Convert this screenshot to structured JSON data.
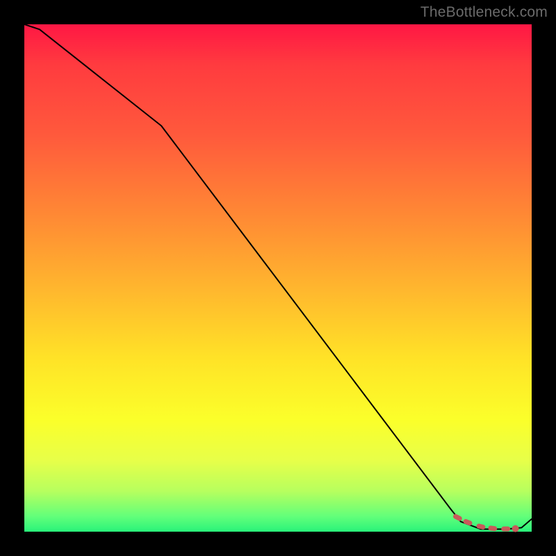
{
  "watermark": "TheBottleneck.com",
  "colors": {
    "background": "#000000",
    "gradient_stops": [
      "#ff1744",
      "#ff3b3f",
      "#ff5a3c",
      "#ff8a34",
      "#ffb62e",
      "#ffe327",
      "#fbff2a",
      "#e7ff49",
      "#b7ff5e",
      "#62ff7a",
      "#29f37a"
    ],
    "curve": "#000000",
    "marker_stroke": "#c85a5a",
    "marker_fill": "#c85a5a"
  },
  "chart_data": {
    "type": "line",
    "title": "",
    "xlabel": "",
    "ylabel": "",
    "xlim": [
      0,
      100
    ],
    "ylim": [
      0,
      100
    ],
    "grid": false,
    "legend": false,
    "series": [
      {
        "name": "bottleneck-curve",
        "x": [
          0,
          3,
          27,
          84,
          86,
          90,
          95,
          98,
          100
        ],
        "y": [
          100,
          99,
          80,
          4.5,
          2.0,
          0.5,
          0.5,
          0.8,
          2.5
        ]
      }
    ],
    "markers": {
      "name": "optimal-range-dashes",
      "x": [
        85.0,
        85.8,
        87.0,
        87.8,
        89.6,
        90.4,
        91.9,
        92.7,
        94.5,
        95.3,
        96.8
      ],
      "y": [
        3.0,
        2.6,
        2.0,
        1.7,
        1.1,
        0.9,
        0.7,
        0.6,
        0.55,
        0.55,
        0.6
      ],
      "end_dot": {
        "x": 96.8,
        "y": 0.6
      }
    }
  }
}
